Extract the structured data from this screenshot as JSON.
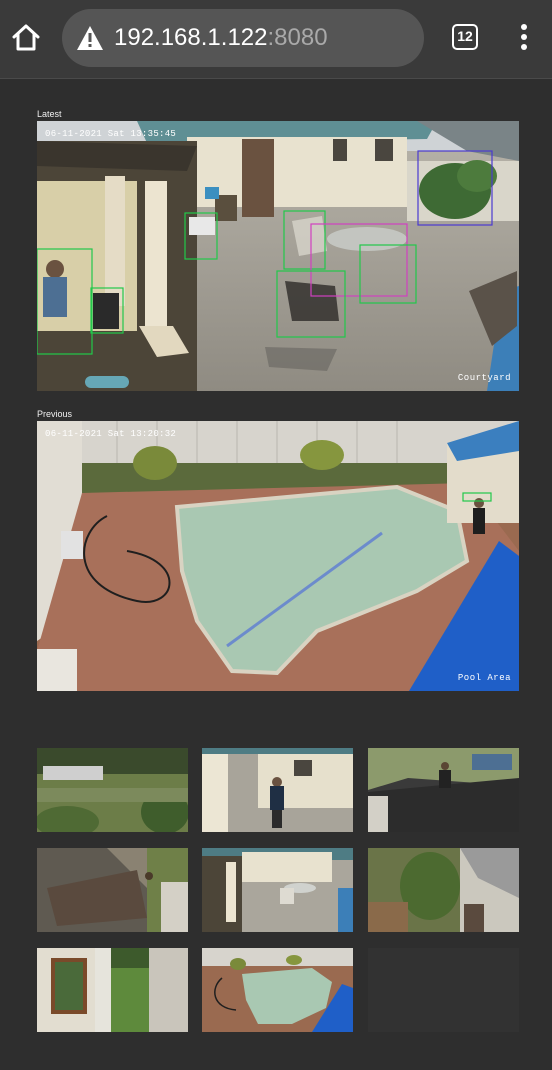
{
  "browser": {
    "url_host": "192.168.1.122",
    "url_port": ":8080",
    "tab_count": "12"
  },
  "latest": {
    "label": "Latest",
    "timestamp": "06-11-2021 Sat 13:35:45",
    "camera": "Courtyard"
  },
  "previous": {
    "label": "Previous",
    "timestamp": "06-11-2021 Sat 13:20:32",
    "camera": "Pool Area"
  },
  "colors": {
    "page_bg": "#2e2e2e",
    "detection_green": "#22c84a",
    "detection_magenta": "#d040c0",
    "detection_blue": "#4a3ad0"
  },
  "icons": [
    "home-icon",
    "warning-icon",
    "tab-switcher-icon",
    "overflow-menu-icon"
  ]
}
